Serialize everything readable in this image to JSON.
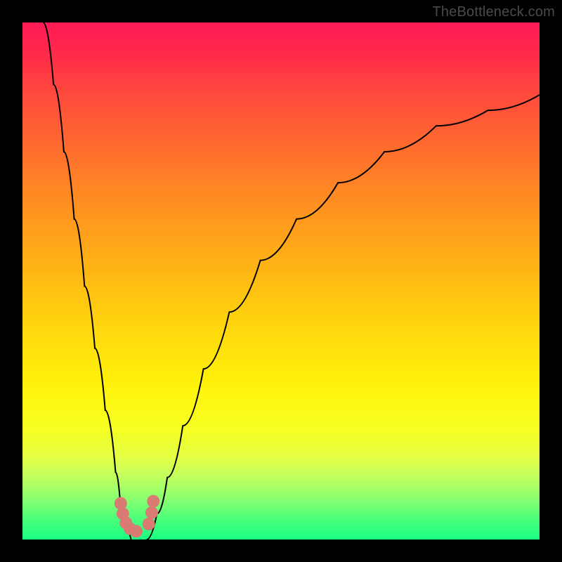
{
  "watermark": {
    "text": "TheBottleneck.com"
  },
  "chart_data": {
    "type": "line",
    "title": "",
    "xlabel": "",
    "ylabel": "",
    "xlim": [
      0,
      100
    ],
    "ylim": [
      0,
      100
    ],
    "gradient_stops": [
      {
        "pos": 0,
        "color": "#ff1a55"
      },
      {
        "pos": 50,
        "color": "#ffc400"
      },
      {
        "pos": 80,
        "color": "#f7ff1e"
      },
      {
        "pos": 100,
        "color": "#1aff82"
      }
    ],
    "series": [
      {
        "name": "left-branch",
        "x": [
          4,
          6,
          8,
          10,
          12,
          14,
          16,
          18,
          19,
          20,
          21
        ],
        "y": [
          100,
          88,
          75,
          62,
          49,
          37,
          25,
          13,
          6,
          2,
          0
        ]
      },
      {
        "name": "right-branch",
        "x": [
          24,
          26,
          28,
          31,
          35,
          40,
          46,
          53,
          61,
          70,
          80,
          90,
          100
        ],
        "y": [
          0,
          5,
          12,
          22,
          33,
          44,
          54,
          62,
          69,
          75,
          80,
          83,
          86
        ]
      }
    ],
    "markers": [
      {
        "x": 19.0,
        "y": 7.0
      },
      {
        "x": 19.4,
        "y": 5.0
      },
      {
        "x": 20.0,
        "y": 3.2
      },
      {
        "x": 20.8,
        "y": 2.1
      },
      {
        "x": 22.0,
        "y": 1.6
      },
      {
        "x": 24.4,
        "y": 3.0
      },
      {
        "x": 25.0,
        "y": 5.2
      },
      {
        "x": 25.3,
        "y": 7.4
      }
    ]
  }
}
